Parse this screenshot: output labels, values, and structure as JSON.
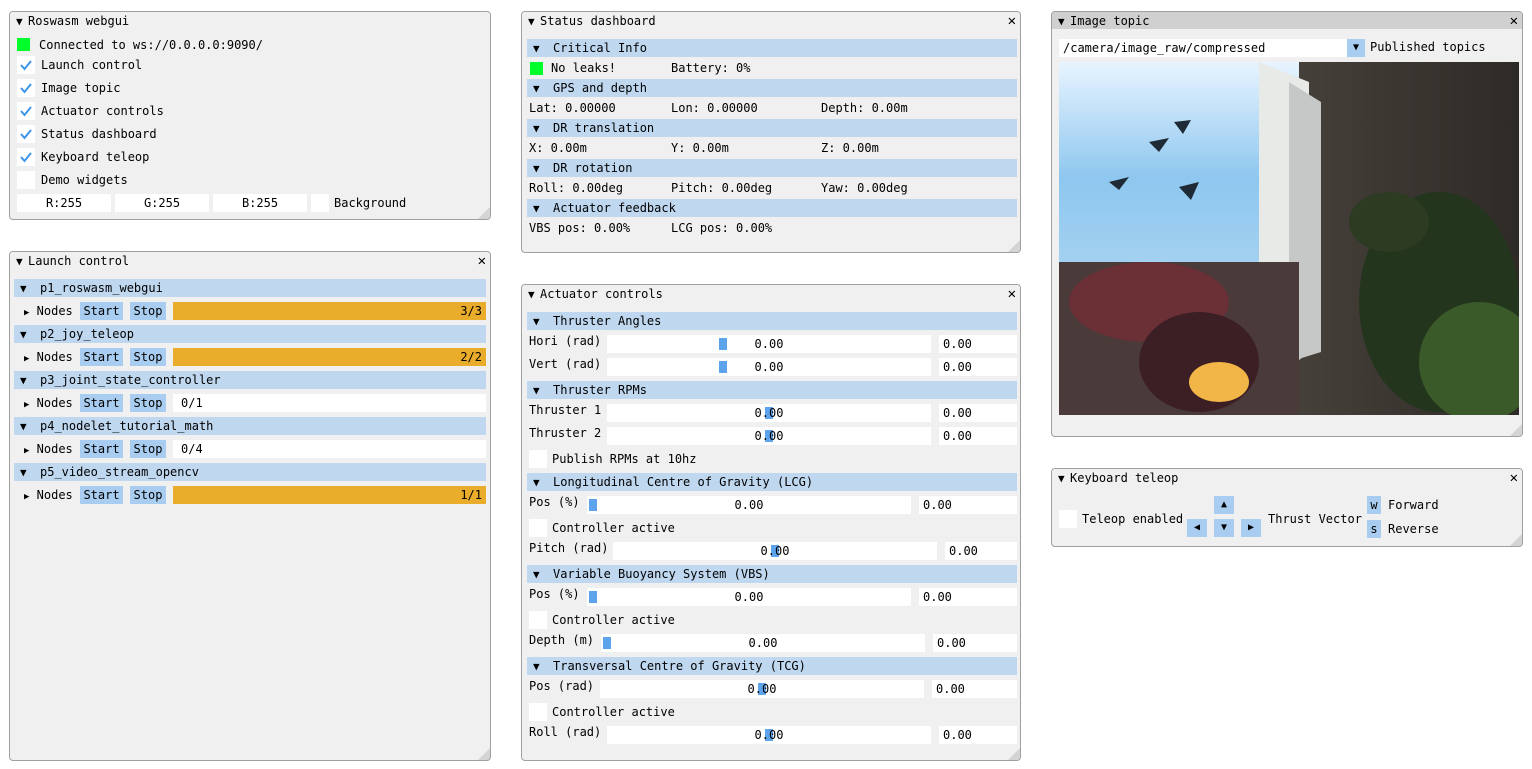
{
  "main": {
    "title": "Roswasm webgui",
    "connection": "Connected to ws://0.0.0.0:9090/",
    "windows": [
      {
        "label": "Launch control",
        "checked": true
      },
      {
        "label": "Image topic",
        "checked": true
      },
      {
        "label": "Actuator controls",
        "checked": true
      },
      {
        "label": "Status dashboard",
        "checked": true
      },
      {
        "label": "Keyboard teleop",
        "checked": true
      },
      {
        "label": "Demo widgets",
        "checked": false
      }
    ],
    "r": "R:255",
    "g": "G:255",
    "b": "B:255",
    "background_label": "Background"
  },
  "launch": {
    "title": "Launch control",
    "nodes_label": "Nodes",
    "start_label": "Start",
    "stop_label": "Stop",
    "items": [
      {
        "name": "p1_roswasm_webgui",
        "status": "3/3",
        "progress": 1.0
      },
      {
        "name": "p2_joy_teleop",
        "status": "2/2",
        "progress": 1.0
      },
      {
        "name": "p3_joint_state_controller",
        "status": "0/1",
        "progress": 0.0
      },
      {
        "name": "p4_nodelet_tutorial_math",
        "status": "0/4",
        "progress": 0.0
      },
      {
        "name": "p5_video_stream_opencv",
        "status": "1/1",
        "progress": 1.0
      }
    ]
  },
  "status": {
    "title": "Status dashboard",
    "critical_header": "Critical Info",
    "leaks": "No leaks!",
    "battery": "Battery: 0%",
    "gps_header": "GPS and depth",
    "lat": "Lat: 0.00000",
    "lon": "Lon: 0.00000",
    "depth": "Depth: 0.00m",
    "drt_header": "DR translation",
    "x": "X: 0.00m",
    "y": "Y: 0.00m",
    "z": "Z: 0.00m",
    "drr_header": "DR rotation",
    "roll": "Roll: 0.00deg",
    "pitch": "Pitch: 0.00deg",
    "yaw": "Yaw: 0.00deg",
    "feedback_header": "Actuator feedback",
    "vbs": "VBS pos: 0.00%",
    "lcg": "LCG pos: 0.00%"
  },
  "actuator": {
    "title": "Actuator controls",
    "angles_header": "Thruster Angles",
    "hori_label": "Hori (rad)",
    "hori_value": "0.00",
    "hori_input": "0.00",
    "vert_label": "Vert (rad)",
    "vert_value": "0.00",
    "vert_input": "0.00",
    "rpm_header": "Thruster RPMs",
    "t1_label": "Thruster 1",
    "t1_value": "0.00",
    "t1_input": "0.00",
    "t2_label": "Thruster 2",
    "t2_value": "0.00",
    "t2_input": "0.00",
    "publish_label": "Publish RPMs at 10hz",
    "lcg_header": "Longitudinal Centre of Gravity (LCG)",
    "lcg_pos_label": "Pos (%)",
    "lcg_pos_value": "0.00",
    "lcg_pos_input": "0.00",
    "lcg_ctrl_label": "Controller active",
    "pitch_label": "Pitch (rad)",
    "pitch_value": "0.00",
    "pitch_input": "0.00",
    "vbs_header": "Variable Buoyancy System (VBS)",
    "vbs_pos_label": "Pos (%)",
    "vbs_pos_value": "0.00",
    "vbs_pos_input": "0.00",
    "vbs_ctrl_label": "Controller active",
    "depth_label": "Depth (m)",
    "depth_value": "0.00",
    "depth_input": "0.00",
    "tcg_header": "Transversal Centre of Gravity (TCG)",
    "tcg_pos_label": "Pos (rad)",
    "tcg_pos_value": "0.00",
    "tcg_pos_input": "0.00",
    "tcg_ctrl_label": "Controller active",
    "roll_label": "Roll (rad)",
    "roll_value": "0.00",
    "roll_input": "0.00"
  },
  "image": {
    "title": "Image topic",
    "topic": "/camera/image_raw/compressed",
    "published_label": "Published topics"
  },
  "teleop": {
    "title": "Keyboard teleop",
    "enabled_label": "Teleop enabled",
    "thrust_label": "Thrust Vector",
    "w_key": "w",
    "forward_label": "Forward",
    "s_key": "s",
    "reverse_label": "Reverse"
  },
  "colors": {
    "header": "#bfd8f0",
    "button": "#a8cdf0",
    "progress": "#e9ad2b",
    "led": "#00ff2a",
    "slider_grab": "#5ea4ec"
  }
}
